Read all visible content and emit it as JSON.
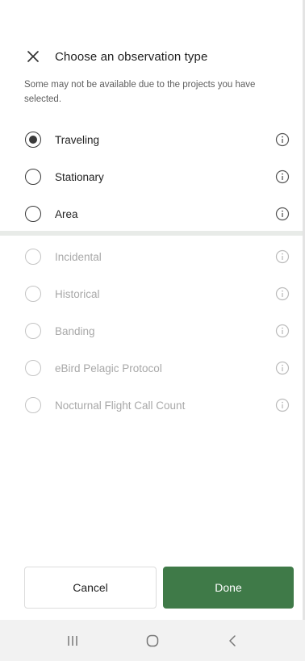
{
  "header": {
    "title": "Choose an observation type",
    "close_icon": "close-icon"
  },
  "subtitle": "Some may not be available due to the projects you have selected.",
  "enabled_options": [
    {
      "label": "Traveling",
      "selected": true
    },
    {
      "label": "Stationary",
      "selected": false
    },
    {
      "label": "Area",
      "selected": false
    }
  ],
  "disabled_options": [
    {
      "label": "Incidental"
    },
    {
      "label": "Historical"
    },
    {
      "label": "Banding"
    },
    {
      "label": "eBird Pelagic Protocol"
    },
    {
      "label": "Nocturnal Flight Call Count"
    }
  ],
  "actions": {
    "cancel_label": "Cancel",
    "done_label": "Done"
  },
  "colors": {
    "primary": "#3f7a48",
    "disabled_text": "#a8a8a8"
  },
  "navbar": {
    "icons": [
      "recent-apps-icon",
      "home-icon",
      "back-icon"
    ]
  }
}
